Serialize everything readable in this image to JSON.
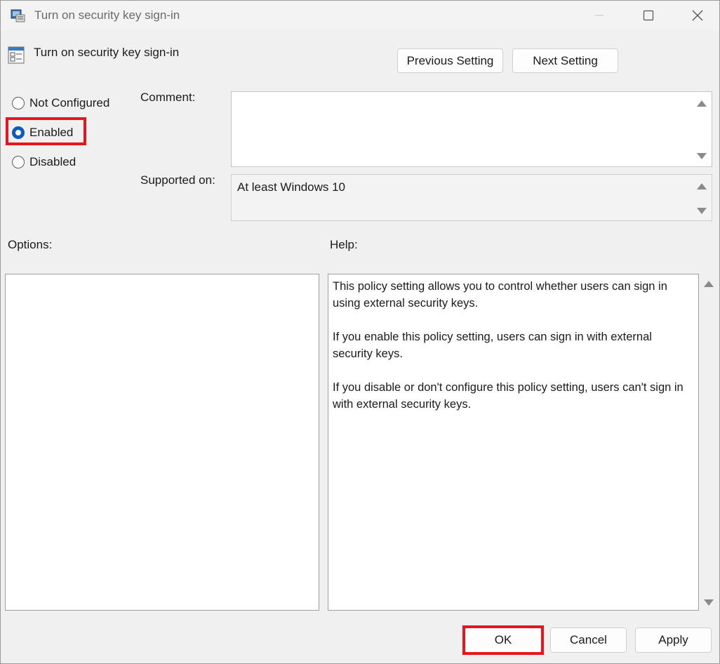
{
  "window": {
    "title": "Turn on security key sign-in",
    "icon": "policy-editor-icon"
  },
  "header": {
    "title": "Turn on security key sign-in",
    "icon": "policy-setting-icon"
  },
  "nav": {
    "previous_label": "Previous Setting",
    "next_label": "Next Setting"
  },
  "state": {
    "options": [
      {
        "label": "Not Configured",
        "checked": false
      },
      {
        "label": "Enabled",
        "checked": true
      },
      {
        "label": "Disabled",
        "checked": false
      }
    ]
  },
  "comment": {
    "label": "Comment:",
    "value": ""
  },
  "supported": {
    "label": "Supported on:",
    "value": "At least Windows 10"
  },
  "options_panel": {
    "label": "Options:"
  },
  "help_panel": {
    "label": "Help:",
    "paragraphs": [
      "This policy setting allows you to control whether users can sign in using external security keys.",
      "If you enable this policy setting, users can sign in with external security keys.",
      "If you disable or don't configure this policy setting, users can't sign in with external security keys."
    ]
  },
  "footer": {
    "ok_label": "OK",
    "cancel_label": "Cancel",
    "apply_label": "Apply"
  },
  "colors": {
    "highlight": "#e8141e",
    "radio_accent": "#0a5bbd"
  }
}
